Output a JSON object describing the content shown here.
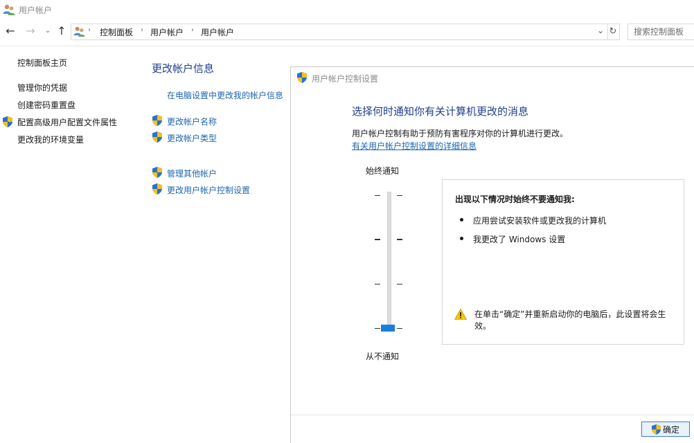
{
  "window": {
    "title": "用户帐户"
  },
  "nav": {
    "back_icon": "back-arrow-icon",
    "forward_icon": "forward-arrow-icon",
    "breadcrumbs": [
      "控制面板",
      "用户帐户",
      "用户帐户"
    ],
    "search_placeholder": "搜索控制面板"
  },
  "sidebar": {
    "items": [
      {
        "label": "控制面板主页"
      },
      {
        "label": "管理你的凭据"
      },
      {
        "label": "创建密码重置盘"
      },
      {
        "label": "配置高级用户配置文件属性"
      },
      {
        "label": "更改我的环境变量"
      }
    ]
  },
  "main": {
    "title": "更改帐户信息",
    "links": [
      {
        "label": "在电脑设置中更改我的帐户信息"
      },
      {
        "label": "更改帐户名称"
      },
      {
        "label": "更改帐户类型"
      },
      {
        "label": "管理其他帐户"
      },
      {
        "label": "更改用户帐户控制设置"
      }
    ]
  },
  "uac_dialog": {
    "title": "用户帐户控制设置",
    "heading": "选择何时通知你有关计算机更改的消息",
    "description": "用户帐户控制有助于预防有害程序对你的计算机进行更改。",
    "more_link": "有关用户帐户控制设置的详细信息",
    "slider": {
      "top_label": "始终通知",
      "bottom_label": "从不通知",
      "levels": 4,
      "selected_level": 1
    },
    "info": {
      "title": "出现以下情况时始终不要通知我:",
      "bullets": [
        "应用尝试安装软件或更改我的计算机",
        "我更改了 Windows 设置"
      ],
      "warning": "在单击“确定”并重新启动你的电脑后，此设置将会生效。"
    },
    "ok_label": "确定"
  },
  "colors": {
    "link": "#1d64b3",
    "heading": "#1e3e8c",
    "slider_thumb": "#1a7fd8"
  }
}
